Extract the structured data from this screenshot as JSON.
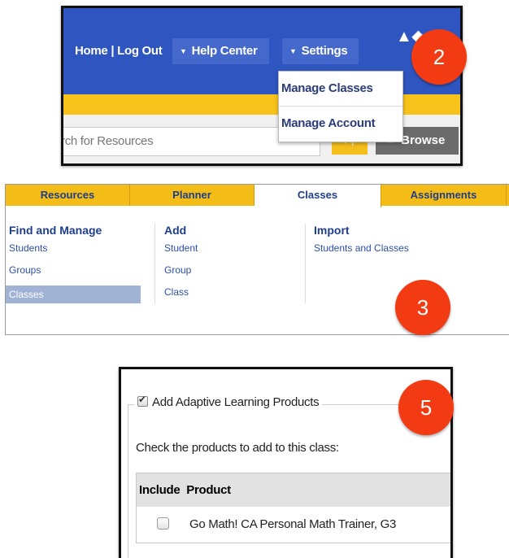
{
  "panel1": {
    "nav_home_logout": "Home | Log Out",
    "help_center_label": "Help Center",
    "settings_label": "Settings",
    "settings_menu": [
      "Manage Classes",
      "Manage Account"
    ],
    "search_placeholder_visible": "rch for Resources",
    "browse_label": "Browse",
    "badge": "2"
  },
  "panel2": {
    "tabs": [
      "Resources",
      "Planner",
      "Classes",
      "Assignments"
    ],
    "active_tab": "Classes",
    "find_manage": {
      "heading": "Find and Manage",
      "items": [
        "Students",
        "Groups",
        "Classes"
      ]
    },
    "add": {
      "heading": "Add",
      "items": [
        "Student",
        "Group",
        "Class"
      ]
    },
    "import": {
      "heading": "Import",
      "items": [
        "Students and Classes"
      ]
    },
    "badge": "3"
  },
  "panel3": {
    "legend": "Add Adaptive Learning Products",
    "instruction": "Check the products to add to this class:",
    "col_include": "Include",
    "col_product": "Product",
    "product_row": "Go Math! CA Personal Math Trainer, G3",
    "badge": "5"
  },
  "colors": {
    "blue_bar": "#2f56c0",
    "yellow": "#f4bc16",
    "badge_red": "#f23b13",
    "link_blue": "#2a4fa6"
  }
}
